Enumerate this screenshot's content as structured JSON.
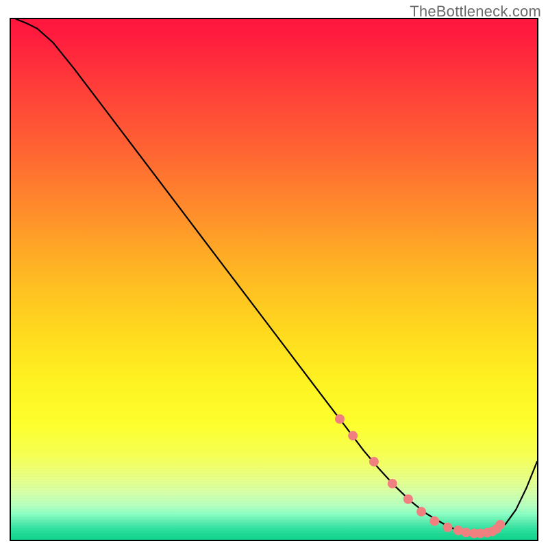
{
  "watermark": "TheBottleneck.com",
  "chart_data": {
    "type": "line",
    "title": "",
    "xlabel": "",
    "ylabel": "",
    "xlim": [
      0,
      100
    ],
    "ylim": [
      0,
      100
    ],
    "series": [
      {
        "name": "curve",
        "x": [
          1,
          3,
          5,
          8,
          12,
          18,
          24,
          30,
          36,
          42,
          48,
          54,
          60,
          64,
          67,
          70,
          73,
          76,
          79,
          82,
          84,
          86,
          88,
          90,
          92,
          94,
          96,
          98,
          100
        ],
        "y": [
          100,
          99.2,
          98.2,
          95.5,
          90.5,
          82.5,
          74.5,
          66.5,
          58.5,
          50.5,
          42.5,
          34.5,
          26.5,
          21.2,
          17.2,
          13.6,
          10.3,
          7.4,
          5.0,
          3.2,
          2.2,
          1.6,
          1.3,
          1.3,
          1.6,
          3.0,
          5.8,
          10.0,
          15.0
        ]
      }
    ],
    "highlight_points": {
      "name": "pink-dots",
      "color": "#f08080",
      "x": [
        62.5,
        65.0,
        69.0,
        72.5,
        75.5,
        78.0,
        80.5,
        83.0,
        85.0,
        86.5,
        88.0,
        89.2,
        90.5,
        91.5,
        92.3,
        93.0
      ],
      "y": [
        23.2,
        20.0,
        15.0,
        10.8,
        7.8,
        5.4,
        3.6,
        2.4,
        1.8,
        1.4,
        1.25,
        1.25,
        1.35,
        1.6,
        2.1,
        2.9
      ]
    },
    "gradient_stops": [
      {
        "pos": 0.0,
        "color": "#ff173e"
      },
      {
        "pos": 0.25,
        "color": "#ff7a2e"
      },
      {
        "pos": 0.5,
        "color": "#ffd020"
      },
      {
        "pos": 0.72,
        "color": "#fff82a"
      },
      {
        "pos": 0.88,
        "color": "#e6ff82"
      },
      {
        "pos": 0.95,
        "color": "#9dffc0"
      },
      {
        "pos": 1.0,
        "color": "#15d48e"
      }
    ]
  }
}
